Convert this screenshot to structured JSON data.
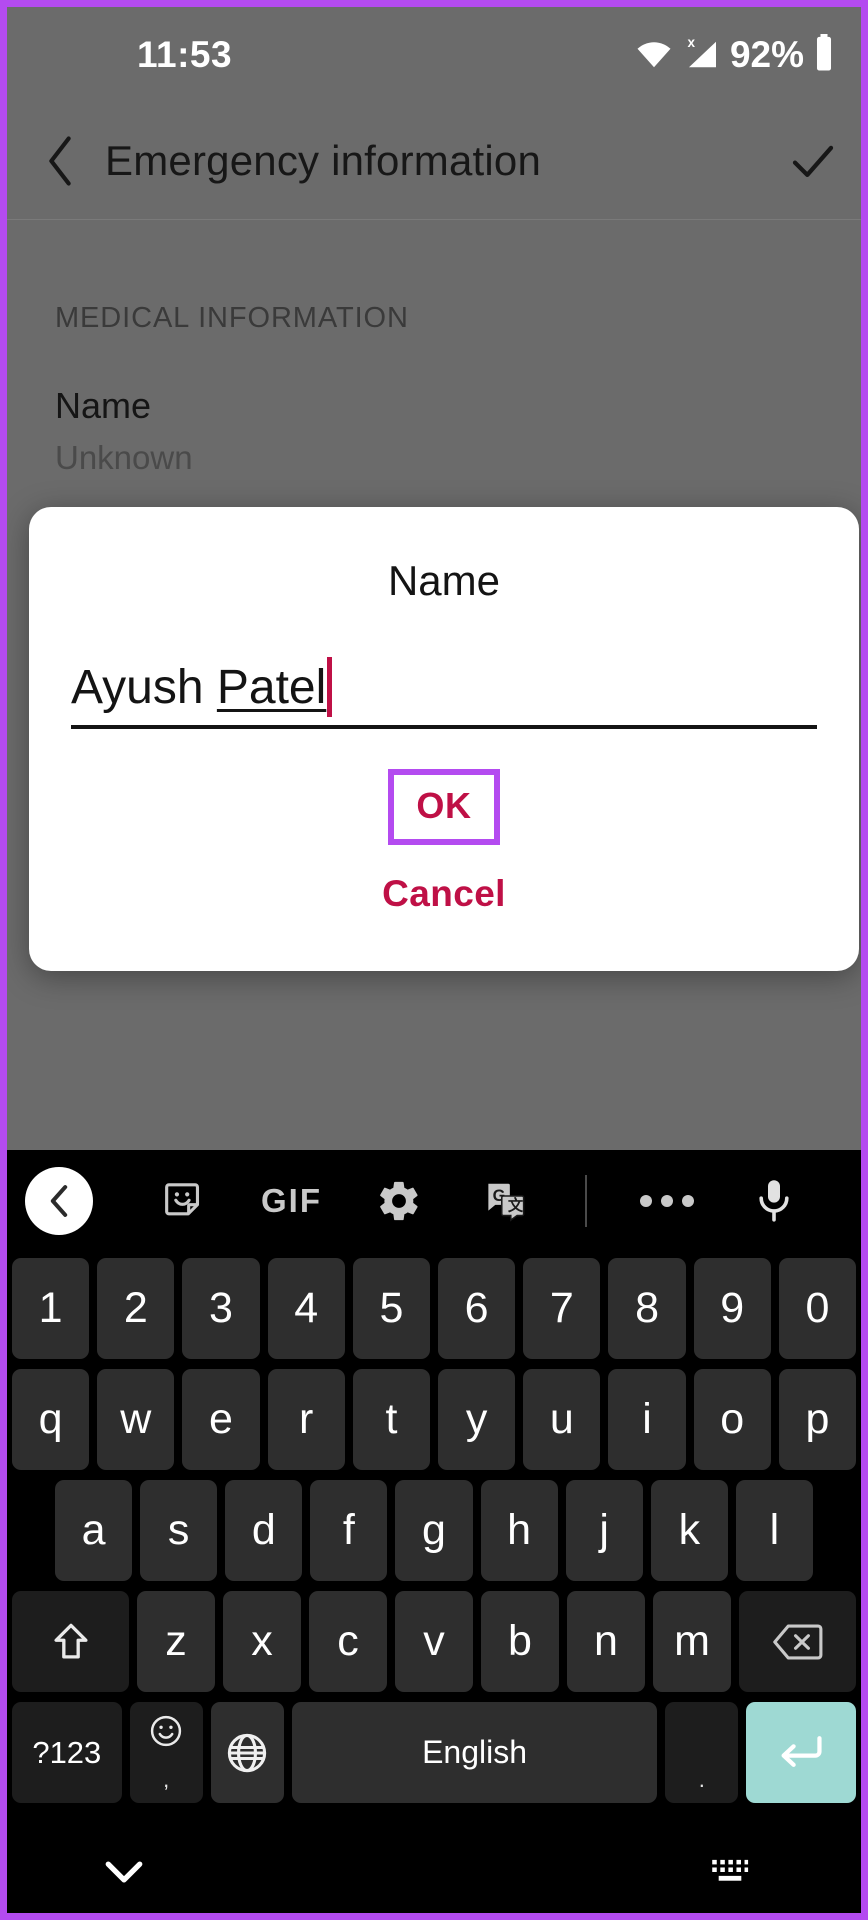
{
  "status_bar": {
    "time": "11:53",
    "battery_percent": "92%",
    "icons": [
      "wifi-icon",
      "cellular-signal-no-sim-icon",
      "battery-icon"
    ]
  },
  "app_bar": {
    "back_icon": "chevron-left-icon",
    "title": "Emergency information",
    "confirm_icon": "check-icon"
  },
  "content": {
    "section_header": "MEDICAL INFORMATION",
    "fields": [
      {
        "label": "Name",
        "value": "Unknown"
      }
    ],
    "partially_hidden_value": "None"
  },
  "dialog": {
    "title": "Name",
    "input_value": "Ayush Patel",
    "input_value_plain": "Ayush ",
    "input_value_composing": "Patel",
    "caret_color": "#bf1046",
    "ok_label": "OK",
    "cancel_label": "Cancel",
    "button_color": "#bf1046",
    "highlight_color": "#b44bf0"
  },
  "keyboard": {
    "toolbar": [
      {
        "name": "back-button",
        "icon": "chevron-left-icon",
        "label": ""
      },
      {
        "name": "sticker-button",
        "icon": "sticker-smiley-icon",
        "label": ""
      },
      {
        "name": "gif-button",
        "icon": "gif-icon",
        "label": "GIF"
      },
      {
        "name": "settings-button",
        "icon": "gear-icon",
        "label": ""
      },
      {
        "name": "translate-button",
        "icon": "google-translate-icon",
        "label": ""
      },
      {
        "name": "overflow-button",
        "icon": "more-horizontal-icon",
        "label": ""
      },
      {
        "name": "voice-input-button",
        "icon": "microphone-icon",
        "label": ""
      }
    ],
    "rows": {
      "numbers": [
        "1",
        "2",
        "3",
        "4",
        "5",
        "6",
        "7",
        "8",
        "9",
        "0"
      ],
      "top": [
        "q",
        "w",
        "e",
        "r",
        "t",
        "y",
        "u",
        "i",
        "o",
        "p"
      ],
      "home": [
        "a",
        "s",
        "d",
        "f",
        "g",
        "h",
        "j",
        "k",
        "l"
      ],
      "bottom": [
        "z",
        "x",
        "c",
        "v",
        "b",
        "n",
        "m"
      ],
      "shift_icon": "shift-up-arrow-icon",
      "backspace_icon": "backspace-icon"
    },
    "bottom_row": {
      "symbols_label": "?123",
      "emoji_icon": "emoji-smiley-icon",
      "emoji_sub_label": ",",
      "language_icon": "globe-icon",
      "space_label": "English",
      "period_label": ".",
      "enter_icon": "enter-return-icon",
      "enter_color": "#9ed9d3"
    }
  },
  "nav_bar": {
    "hide_keyboard_icon": "chevron-down-icon",
    "switch_keyboard_icon": "keyboard-icon"
  }
}
